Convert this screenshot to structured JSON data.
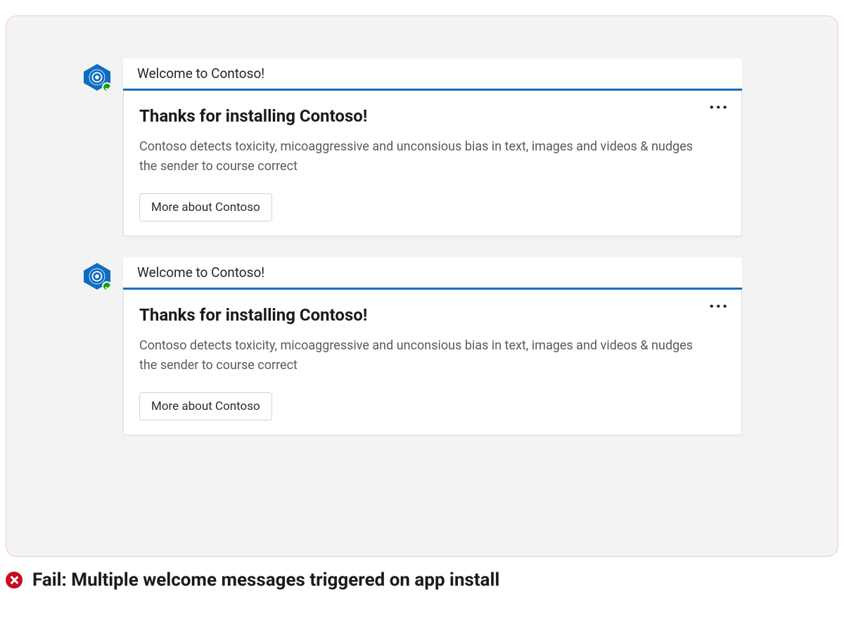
{
  "messages": [
    {
      "header": "Welcome to Contoso!",
      "title": "Thanks for installing Contoso!",
      "description": "Contoso detects toxicity, micoaggressive and unconsious bias in text, images and videos & nudges the sender to course correct",
      "button": "More about Contoso"
    },
    {
      "header": "Welcome to Contoso!",
      "title": "Thanks for installing Contoso!",
      "description": "Contoso detects toxicity, micoaggressive and unconsious bias in text, images and videos & nudges the sender to course correct",
      "button": "More about Contoso"
    }
  ],
  "caption": "Fail: Multiple welcome messages triggered on app install"
}
